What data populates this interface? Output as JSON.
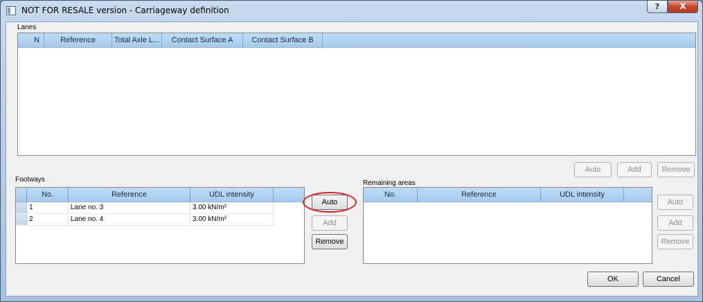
{
  "window": {
    "title": "NOT FOR RESALE version - Carriageway definition",
    "help_label": "?",
    "close_label": "X"
  },
  "lanes": {
    "label": "Lanes",
    "columns": [
      "N",
      "Reference",
      "Total Axle L...",
      "Contact Surface A",
      "Contact Surface B"
    ],
    "buttons": {
      "auto": "Auto",
      "add": "Add",
      "remove": "Remove"
    }
  },
  "footways": {
    "label": "Footways",
    "columns": [
      "No.",
      "Reference",
      "UDL intensity"
    ],
    "rows": [
      {
        "no": "1",
        "reference": "Lane no. 3",
        "udl": "3.00 kN/m²"
      },
      {
        "no": "2",
        "reference": "Lane no. 4",
        "udl": "3.00 kN/m²"
      }
    ],
    "buttons": {
      "auto": "Auto",
      "add": "Add",
      "remove": "Remove"
    }
  },
  "remaining": {
    "label": "Remaining areas",
    "columns": [
      "No.",
      "Reference",
      "UDL intensity"
    ],
    "buttons": {
      "auto": "Auto",
      "add": "Add",
      "remove": "Remove"
    }
  },
  "dialog_buttons": {
    "ok": "OK",
    "cancel": "Cancel"
  },
  "colors": {
    "highlight": "#d32020"
  }
}
